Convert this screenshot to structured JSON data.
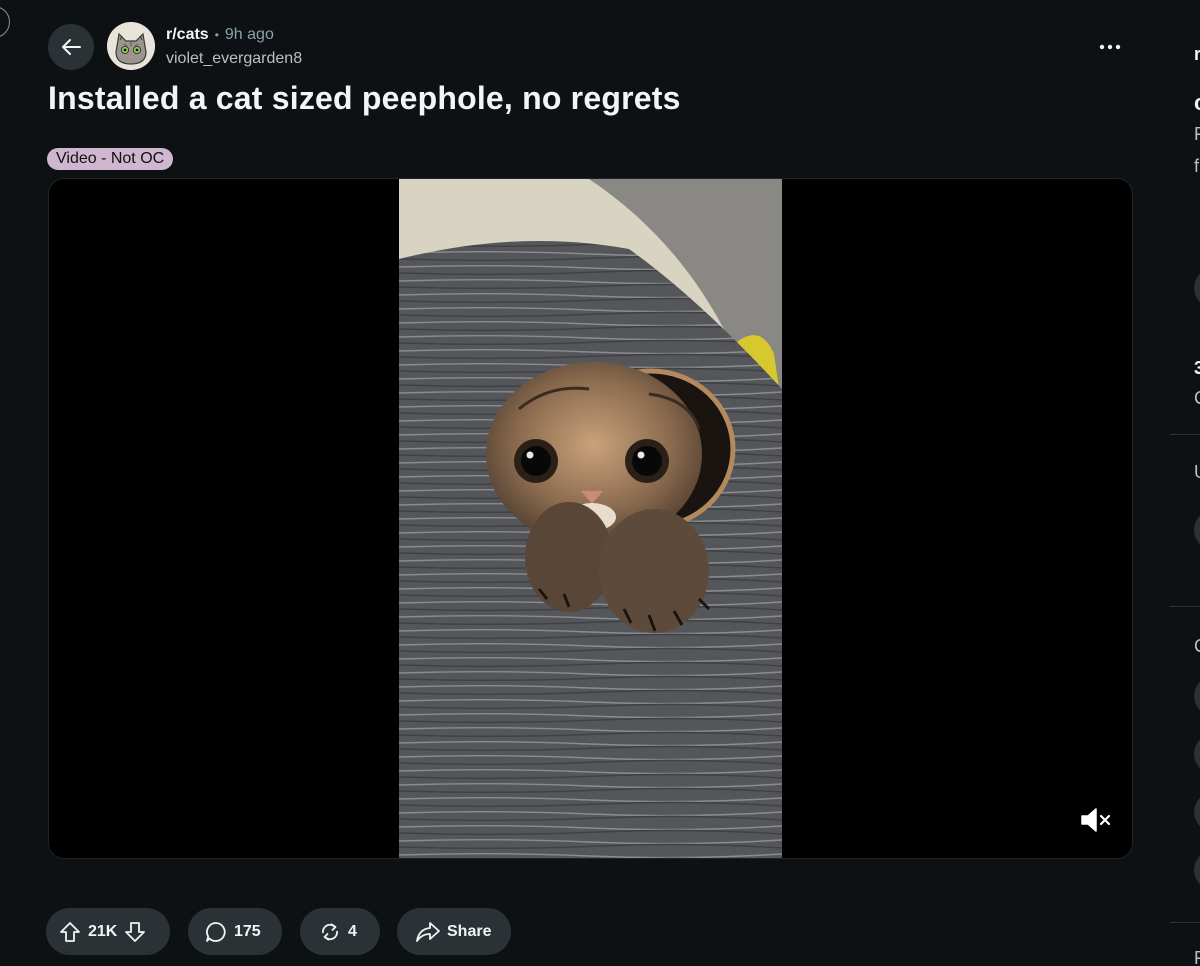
{
  "post": {
    "subreddit": "r/cats",
    "separator": "•",
    "age": "9h ago",
    "author": "violet_evergarden8",
    "title": "Installed a cat sized peephole, no regrets",
    "flair": "Video - Not OC"
  },
  "actions": {
    "upvotes": "21K",
    "comments": "175",
    "crossposts": "4",
    "share_label": "Share"
  },
  "sidebar_fragments": {
    "a": "r",
    "b": "c",
    "c": "F",
    "d": "f",
    "e": "3",
    "f": "C",
    "g": "U",
    "h": "C",
    "i": "F"
  },
  "icons": {
    "back": "arrow-left-icon",
    "more": "more-horizontal-icon",
    "upvote": "arrow-up-icon",
    "downvote": "arrow-down-icon",
    "comment": "comment-bubble-icon",
    "crosspost": "crosspost-icon",
    "share": "share-arrow-icon",
    "mute": "muted-speaker-icon"
  },
  "colors": {
    "background": "#0e1113",
    "button": "#2a3236",
    "flair_bg": "#cfb7cf",
    "muted_text": "#8ba2ad"
  }
}
